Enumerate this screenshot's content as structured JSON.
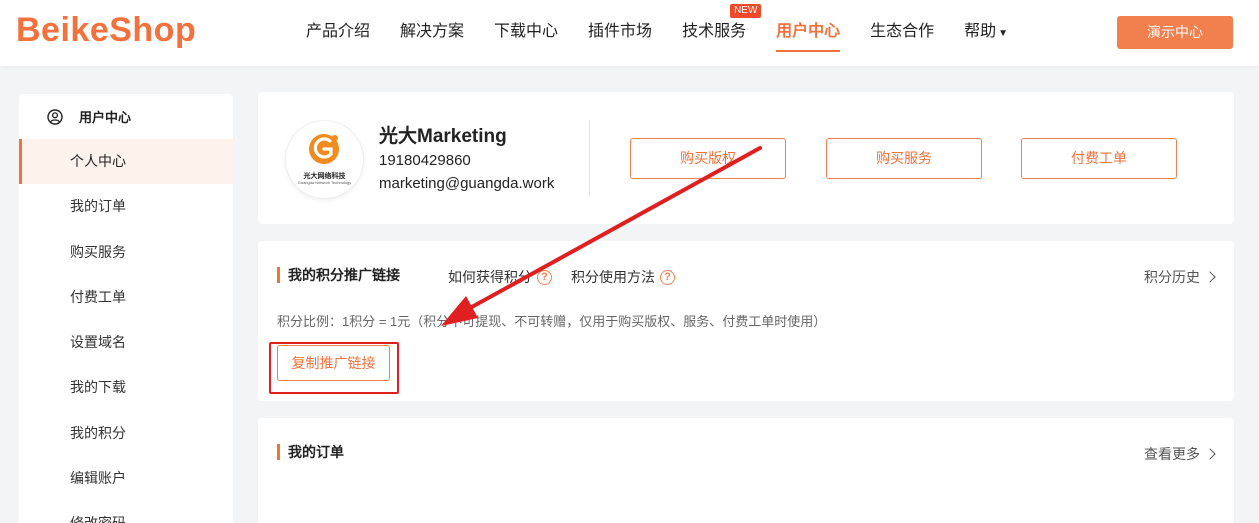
{
  "header": {
    "logo": "BeikeShop",
    "nav": [
      {
        "label": "产品介绍"
      },
      {
        "label": "解决方案"
      },
      {
        "label": "下载中心"
      },
      {
        "label": "插件市场"
      },
      {
        "label": "技术服务",
        "badge": "NEW"
      },
      {
        "label": "用户中心",
        "active": true
      },
      {
        "label": "生态合作"
      },
      {
        "label": "帮助",
        "dropdown": true
      }
    ],
    "demo_button": "演示中心"
  },
  "sidebar": {
    "title": "用户中心",
    "items": [
      {
        "label": "个人中心",
        "active": true
      },
      {
        "label": "我的订单"
      },
      {
        "label": "购买服务"
      },
      {
        "label": "付费工单"
      },
      {
        "label": "设置域名"
      },
      {
        "label": "我的下载"
      },
      {
        "label": "我的积分"
      },
      {
        "label": "编辑账户"
      },
      {
        "label": "修改密码"
      }
    ]
  },
  "profile": {
    "avatar_text": "光大网络科技",
    "avatar_subtext": "Guangda Network Technology",
    "name": "光大Marketing",
    "phone": "19180429860",
    "email": "marketing@guangda.work",
    "buttons": [
      "购买版权",
      "购买服务",
      "付费工单"
    ]
  },
  "points": {
    "title": "我的积分推广链接",
    "help1": "如何获得积分",
    "help2": "积分使用方法",
    "history": "积分历史",
    "ratio": "积分比例：1积分 = 1元（积分不可提现、不可转赠，仅用于购买版权、服务、付费工单时使用）",
    "copy_button": "复制推广链接"
  },
  "orders": {
    "title": "我的订单",
    "more": "查看更多"
  },
  "colors": {
    "accent": "#f2713c",
    "annotation": "#e02020"
  }
}
